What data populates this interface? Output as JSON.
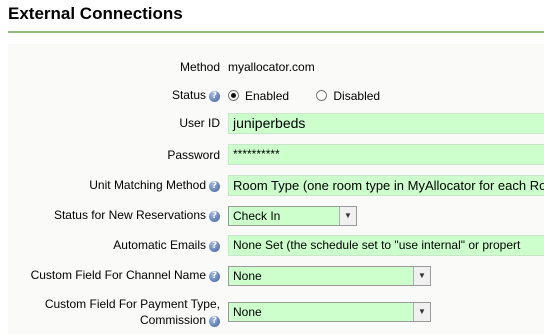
{
  "page": {
    "title": "External Connections"
  },
  "rows": {
    "method": {
      "label": "Method",
      "value": "myallocator.com"
    },
    "status": {
      "label": "Status",
      "options": [
        "Enabled",
        "Disabled"
      ],
      "selected": "Enabled"
    },
    "user_id": {
      "label": "User ID",
      "value": "juniperbeds"
    },
    "password": {
      "label": "Password",
      "value": "**********"
    },
    "unit_matching": {
      "label": "Unit Matching Method",
      "value": "Room Type (one room type in MyAllocator for each Ro"
    },
    "new_res_status": {
      "label": "Status for New Reservations",
      "value": "Check In"
    },
    "auto_emails": {
      "label": "Automatic Emails",
      "value": "None Set (the schedule set to \"use internal\" or propert"
    },
    "channel_name": {
      "label": "Custom Field For Channel Name",
      "value": "None"
    },
    "payment_type": {
      "label_line1": "Custom Field For Payment Type,",
      "label_line2": "Commission",
      "value": "None"
    }
  },
  "icons": {
    "help": "help-icon",
    "dropdown": "chevron-down-icon"
  },
  "colors": {
    "field_bg": "#ccffcc",
    "rule": "#8fbc7a"
  }
}
